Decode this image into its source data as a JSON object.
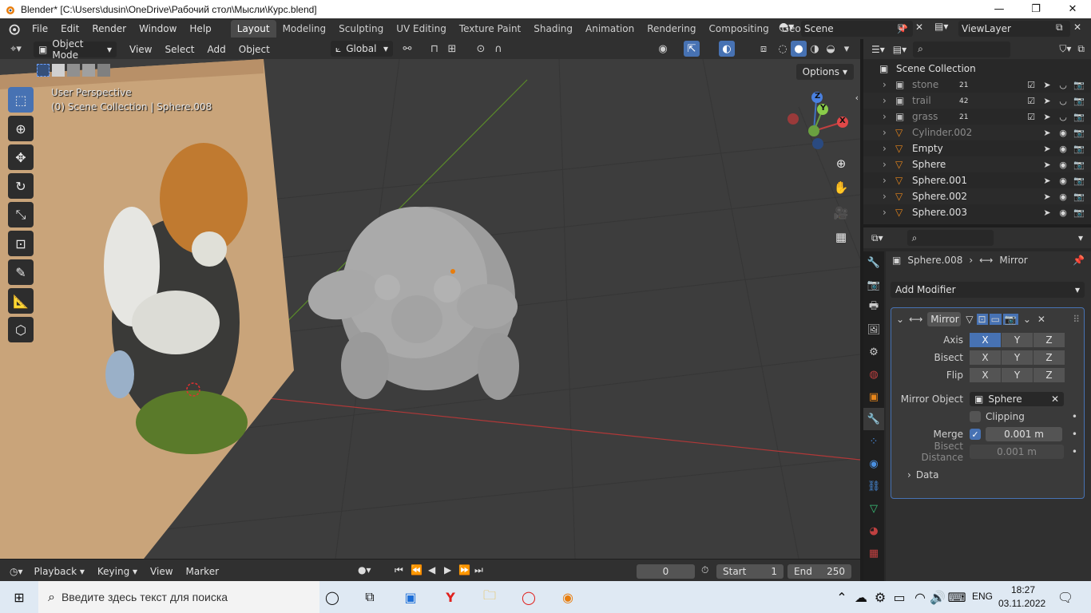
{
  "window": {
    "title": "Blender* [C:\\Users\\dusin\\OneDrive\\Рабочий стол\\Мысли\\Курс.blend]",
    "min_label": "—",
    "max_label": "❐",
    "close_label": "✕"
  },
  "menu": {
    "file": "File",
    "edit": "Edit",
    "render": "Render",
    "window": "Window",
    "help": "Help"
  },
  "workspaces": [
    "Layout",
    "Modeling",
    "Sculpting",
    "UV Editing",
    "Texture Paint",
    "Shading",
    "Animation",
    "Rendering",
    "Compositing",
    "Geometry Noc"
  ],
  "scene": "Scene",
  "view_layer": "ViewLayer",
  "viewport_header": {
    "mode": "Object Mode",
    "view": "View",
    "select": "Select",
    "add": "Add",
    "object": "Object",
    "orientation": "Global"
  },
  "viewport": {
    "perspective": "User Perspective",
    "collection_info": "(0) Scene Collection | Sphere.008",
    "options": "Options",
    "gizmo_x": "X",
    "gizmo_y": "Y",
    "gizmo_z": "Z"
  },
  "timeline": {
    "playback": "Playback",
    "keying": "Keying",
    "view": "View",
    "marker": "Marker",
    "current_frame": "0",
    "start_label": "Start",
    "start_value": "1",
    "end_label": "End",
    "end_value": "250"
  },
  "outliner": {
    "root": "Scene Collection",
    "items": [
      {
        "name": "stone",
        "count": "21",
        "dim": true
      },
      {
        "name": "trail",
        "count": "42",
        "dim": true
      },
      {
        "name": "grass",
        "count": "21",
        "dim": true
      },
      {
        "name": "Cylinder.002",
        "count": "",
        "dim": true
      },
      {
        "name": "Empty",
        "count": "",
        "dim": false
      },
      {
        "name": "Sphere",
        "count": "",
        "dim": false
      },
      {
        "name": "Sphere.001",
        "count": "",
        "dim": false
      },
      {
        "name": "Sphere.002",
        "count": "",
        "dim": false
      },
      {
        "name": "Sphere.003",
        "count": "",
        "dim": false
      }
    ]
  },
  "properties": {
    "object_name": "Sphere.008",
    "modifier_crumb": "Mirror",
    "add_modifier": "Add Modifier",
    "modifier_name": "Mirror",
    "axis_label": "Axis",
    "bisect_label": "Bisect",
    "flip_label": "Flip",
    "x": "X",
    "y": "Y",
    "z": "Z",
    "mirror_object_label": "Mirror Object",
    "mirror_object_value": "Sphere",
    "clipping_label": "Clipping",
    "merge_label": "Merge",
    "merge_value": "0.001 m",
    "bisect_distance_label": "Bisect Distance",
    "bisect_distance_value": "0.001 m",
    "data_label": "Data"
  },
  "taskbar": {
    "search_placeholder": "Введите здесь текст для поиска",
    "lang": "ENG",
    "time": "18:27",
    "date": "03.11.2022"
  }
}
